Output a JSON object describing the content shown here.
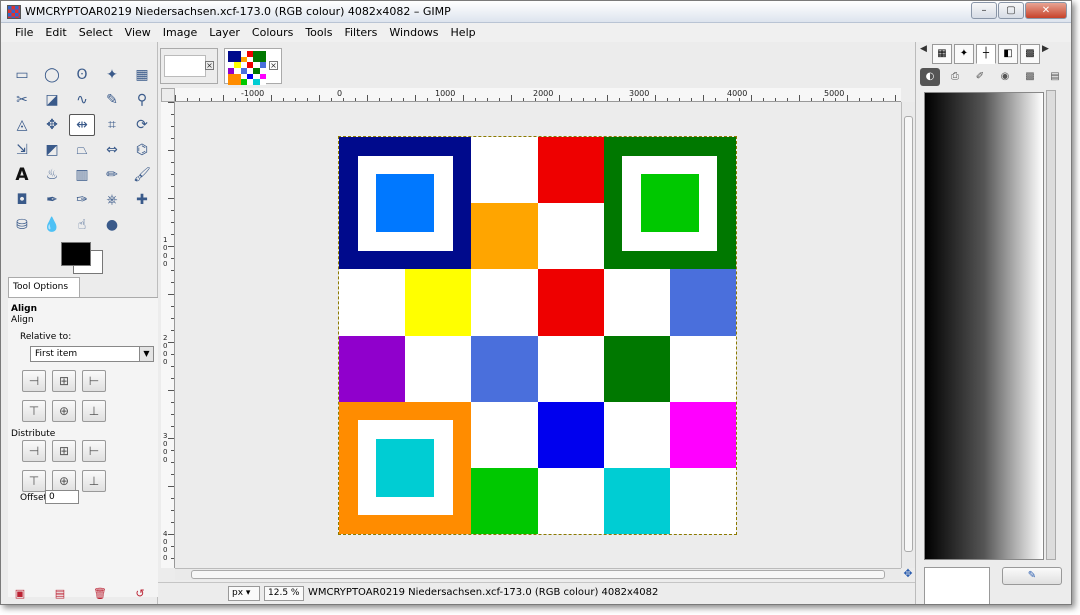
{
  "window": {
    "title": "WMCRYPTOAR0219 Niedersachsen.xcf-173.0 (RGB colour) 4082x4082 – GIMP",
    "minimize": "–",
    "maximize": "▢",
    "close": "✕"
  },
  "menu": [
    "File",
    "Edit",
    "Select",
    "View",
    "Image",
    "Layer",
    "Colours",
    "Tools",
    "Filters",
    "Windows",
    "Help"
  ],
  "toolbox": {
    "tools": [
      {
        "name": "rect-select-icon",
        "glyph": "▭"
      },
      {
        "name": "ellipse-select-icon",
        "glyph": "◯"
      },
      {
        "name": "free-select-icon",
        "glyph": "ʘ"
      },
      {
        "name": "fuzzy-select-icon",
        "glyph": "✦"
      },
      {
        "name": "by-colour-select-icon",
        "glyph": "▦"
      },
      {
        "name": "scissors-icon",
        "glyph": "✂"
      },
      {
        "name": "foreground-select-icon",
        "glyph": "◪"
      },
      {
        "name": "paths-icon",
        "glyph": "∿"
      },
      {
        "name": "colour-picker-icon",
        "glyph": "✎"
      },
      {
        "name": "zoom-icon",
        "glyph": "⚲"
      },
      {
        "name": "measure-icon",
        "glyph": "◬"
      },
      {
        "name": "move-icon",
        "glyph": "✥"
      },
      {
        "name": "align-icon",
        "glyph": "⇹"
      },
      {
        "name": "crop-icon",
        "glyph": "⌗"
      },
      {
        "name": "rotate-icon",
        "glyph": "⟳"
      },
      {
        "name": "scale-icon",
        "glyph": "⇲"
      },
      {
        "name": "shear-icon",
        "glyph": "◩"
      },
      {
        "name": "perspective-icon",
        "glyph": "⏢"
      },
      {
        "name": "flip-icon",
        "glyph": "⇔"
      },
      {
        "name": "cage-icon",
        "glyph": "⌬"
      },
      {
        "name": "text-icon",
        "glyph": "A"
      },
      {
        "name": "bucket-fill-icon",
        "glyph": "♨"
      },
      {
        "name": "blend-icon",
        "glyph": "▥"
      },
      {
        "name": "pencil-icon",
        "glyph": "✏"
      },
      {
        "name": "paintbrush-icon",
        "glyph": "🖌"
      },
      {
        "name": "eraser-icon",
        "glyph": "◘"
      },
      {
        "name": "airbrush-icon",
        "glyph": "✒"
      },
      {
        "name": "ink-icon",
        "glyph": "✑"
      },
      {
        "name": "clone-icon",
        "glyph": "⎈"
      },
      {
        "name": "heal-icon",
        "glyph": "✚"
      },
      {
        "name": "perspective-clone-icon",
        "glyph": "⛁"
      },
      {
        "name": "blur-icon",
        "glyph": "💧"
      },
      {
        "name": "smudge-icon",
        "glyph": "☝"
      },
      {
        "name": "dodge-burn-icon",
        "glyph": "●"
      }
    ],
    "tab_label": "Tool Options",
    "options": {
      "title": "Align",
      "subtitle": "Align",
      "relative_to_label": "Relative to:",
      "relative_to_value": "First item",
      "distribute_label": "Distribute",
      "offset_label": "Offset:",
      "offset_value": "0"
    }
  },
  "ruler": {
    "h_labels": [
      "-1000",
      "0",
      "1000",
      "2000",
      "3000",
      "4000",
      "5000"
    ],
    "v_labels": [
      "1000",
      "2000",
      "3000",
      "4000"
    ]
  },
  "status": {
    "unit": "px",
    "zoom": "12.5 %",
    "text": "WMCRYPTOAR0219 Niedersachsen.xcf-173.0 (RGB colour) 4082x4082"
  },
  "image": {
    "grid": [
      [
        "#000a8c",
        "#000a8c",
        "#ffffff",
        "#ee0000",
        "#007800",
        "#007800"
      ],
      [
        "#000a8c",
        "#000a8c",
        "#ffa500",
        "#ffffff",
        "#007800",
        "#007800"
      ],
      [
        "#ffffff",
        "#ffff00",
        "#ffffff",
        "#ee0000",
        "#ffffff",
        "#4a6fdc"
      ],
      [
        "#9000cc",
        "#ffffff",
        "#4a6fdc",
        "#ffffff",
        "#007800",
        "#ffffff"
      ],
      [
        "#ff8c00",
        "#ff8c00",
        "#ffffff",
        "#0000ee",
        "#ffffff",
        "#ff00ff"
      ],
      [
        "#ff8c00",
        "#ff8c00",
        "#00c800",
        "#ffffff",
        "#00cdd3",
        "#ffffff"
      ]
    ],
    "framed": [
      {
        "row": 0,
        "col": 0,
        "inner": "#0078ff"
      },
      {
        "row": 0,
        "col": 4,
        "inner": "#00c800"
      },
      {
        "row": 4,
        "col": 0,
        "inner": "#00cdd3"
      }
    ]
  },
  "dock": {
    "icons": [
      "patterns-icon",
      "brush-icon",
      "fonts-icon",
      "gradient-icon",
      "palette-icon"
    ]
  }
}
